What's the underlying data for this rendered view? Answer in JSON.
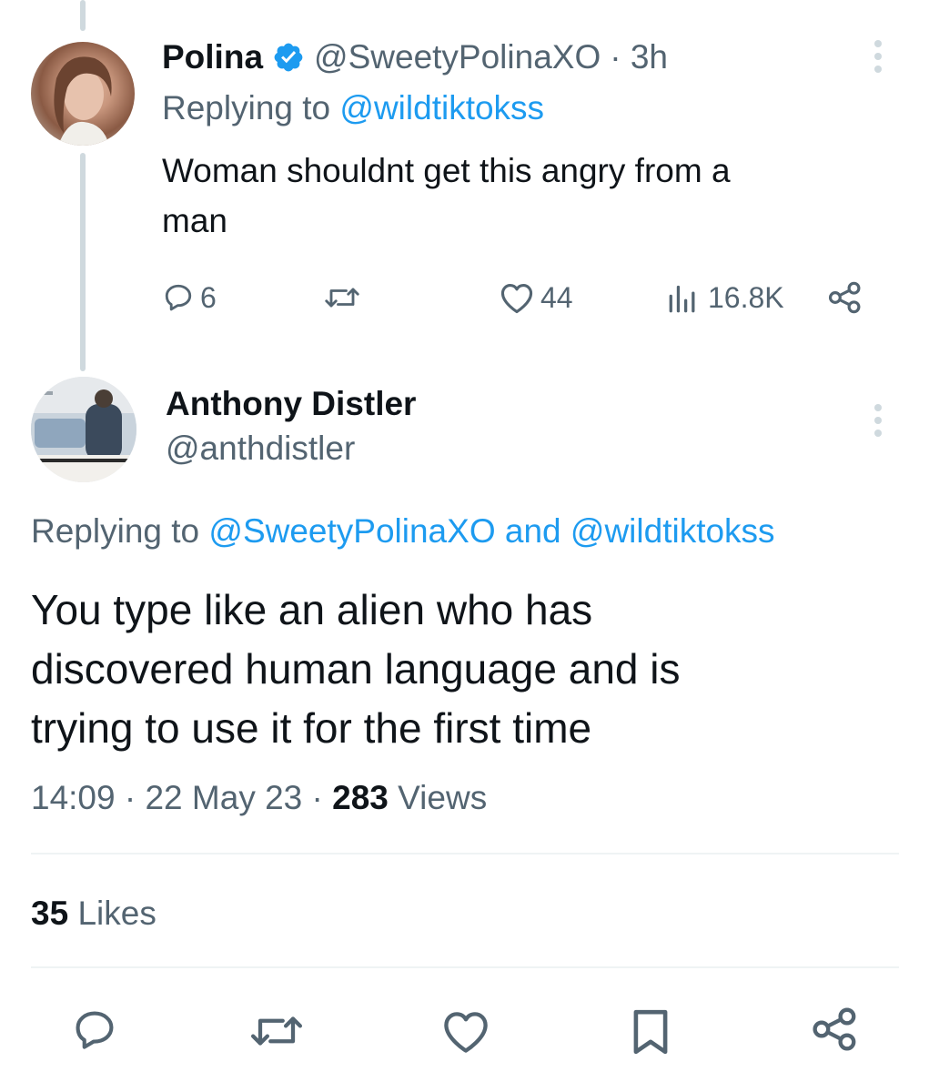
{
  "parent_tweet": {
    "display_name": "Polina",
    "handle": "@SweetyPolinaXO",
    "time": "· 3h",
    "replying_prefix": "Replying to",
    "replying_to": "@wildtiktokss",
    "text_line1": "Woman shouldnt get this angry from a",
    "text_line2": "man",
    "metrics": {
      "replies": "6",
      "likes": "44",
      "views": "16.8K"
    }
  },
  "main_tweet": {
    "display_name": "Anthony Distler",
    "handle": "@anthdistler",
    "replying_prefix": "Replying to",
    "replying_to_1": "@SweetyPolinaXO",
    "replying_and": "and",
    "replying_to_2": "@wildtiktokss",
    "text_line1": "You type like an alien who has",
    "text_line2": "discovered human language and is",
    "text_line3": "trying to use it for the first time",
    "time": "14:09",
    "date": "22 May 23",
    "views_count": "283",
    "views_label": "Views",
    "likes_count": "35",
    "likes_label": "Likes"
  },
  "colors": {
    "accent": "#1d9bf0",
    "muted": "#536471",
    "text": "#0f1419",
    "thread_line": "#cfd9de"
  },
  "icons": {
    "verified": "verified-badge-icon",
    "reply": "reply-icon",
    "retweet": "retweet-icon",
    "like": "heart-icon",
    "views": "views-bar-chart-icon",
    "share": "share-icon",
    "bookmark": "bookmark-icon",
    "more": "more-options-icon"
  }
}
